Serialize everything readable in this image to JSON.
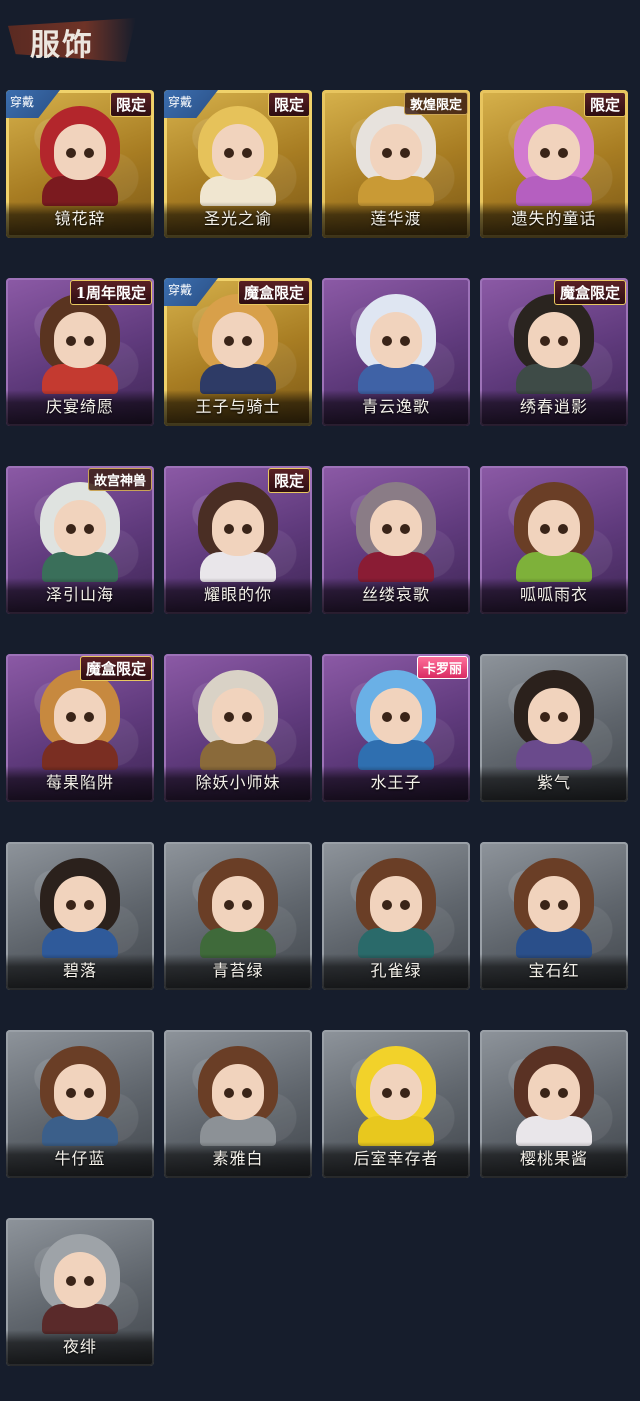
{
  "header": {
    "title": "服饰"
  },
  "costumes": [
    {
      "name": "镜花辞",
      "badge": "限定",
      "badge_style": "",
      "worn": true,
      "frame": "gold",
      "hair": "#b3262c",
      "outfit": "#7b1a1f"
    },
    {
      "name": "圣光之谕",
      "badge": "限定",
      "badge_style": "",
      "worn": true,
      "frame": "gold",
      "hair": "#e6c25a",
      "outfit": "#f0e6d0"
    },
    {
      "name": "莲华渡",
      "badge": "敦煌限定",
      "badge_style": "calli",
      "worn": false,
      "frame": "gold",
      "hair": "#e7e2dd",
      "outfit": "#c99a35"
    },
    {
      "name": "遗失的童话",
      "badge": "限定",
      "badge_style": "",
      "worn": false,
      "frame": "gold",
      "hair": "#d27bcf",
      "outfit": "#b55fc0"
    },
    {
      "name": "庆宴绮愿",
      "badge": "1周年限定",
      "badge_style": "",
      "worn": false,
      "frame": "purple",
      "hair": "#5a3420",
      "outfit": "#c43a30"
    },
    {
      "name": "王子与骑士",
      "badge": "魔盒限定",
      "badge_style": "",
      "worn": true,
      "frame": "gold",
      "hair": "#d8a04a",
      "outfit": "#2e3b66"
    },
    {
      "name": "青云逸歌",
      "badge": "",
      "badge_style": "",
      "worn": false,
      "frame": "purple",
      "hair": "#dfe6f2",
      "outfit": "#3f62a6"
    },
    {
      "name": "绣春逍影",
      "badge": "魔盒限定",
      "badge_style": "",
      "worn": false,
      "frame": "purple",
      "hair": "#2a241f",
      "outfit": "#3e4b47"
    },
    {
      "name": "泽引山海",
      "badge": "故宫神兽",
      "badge_style": "calli",
      "worn": false,
      "frame": "purple",
      "hair": "#dfe3e0",
      "outfit": "#3a6f5a"
    },
    {
      "name": "耀眼的你",
      "badge": "限定",
      "badge_style": "",
      "worn": false,
      "frame": "purple",
      "hair": "#4a2e24",
      "outfit": "#e9e6ea"
    },
    {
      "name": "丝缕哀歌",
      "badge": "",
      "badge_style": "",
      "worn": false,
      "frame": "purple",
      "hair": "#8a7c86",
      "outfit": "#8a1c34"
    },
    {
      "name": "呱呱雨衣",
      "badge": "",
      "badge_style": "",
      "worn": false,
      "frame": "purple",
      "hair": "#6a3e26",
      "outfit": "#7eb13a"
    },
    {
      "name": "莓果陷阱",
      "badge": "魔盒限定",
      "badge_style": "",
      "worn": false,
      "frame": "purple",
      "hair": "#c7893f",
      "outfit": "#7a2e22"
    },
    {
      "name": "除妖小师妹",
      "badge": "",
      "badge_style": "",
      "worn": false,
      "frame": "purple",
      "hair": "#d9d2c6",
      "outfit": "#8a6a3a"
    },
    {
      "name": "水王子",
      "badge": "卡罗丽",
      "badge_style": "pink",
      "worn": false,
      "frame": "purple",
      "hair": "#6ab0e6",
      "outfit": "#2f6fb0"
    },
    {
      "name": "紫气",
      "badge": "",
      "badge_style": "",
      "worn": false,
      "frame": "gray",
      "hair": "#2b211c",
      "outfit": "#6a4a8c"
    },
    {
      "name": "碧落",
      "badge": "",
      "badge_style": "",
      "worn": false,
      "frame": "gray",
      "hair": "#2b211c",
      "outfit": "#2f5a9a"
    },
    {
      "name": "青苔绿",
      "badge": "",
      "badge_style": "",
      "worn": false,
      "frame": "gray",
      "hair": "#6a3e26",
      "outfit": "#3f6a3a"
    },
    {
      "name": "孔雀绿",
      "badge": "",
      "badge_style": "",
      "worn": false,
      "frame": "gray",
      "hair": "#6a3e26",
      "outfit": "#2a6a6a"
    },
    {
      "name": "宝石红",
      "badge": "",
      "badge_style": "",
      "worn": false,
      "frame": "gray",
      "hair": "#6a3e26",
      "outfit": "#2a4f8a"
    },
    {
      "name": "牛仔蓝",
      "badge": "",
      "badge_style": "",
      "worn": false,
      "frame": "gray",
      "hair": "#6a3e26",
      "outfit": "#3b5f8a"
    },
    {
      "name": "素雅白",
      "badge": "",
      "badge_style": "",
      "worn": false,
      "frame": "gray",
      "hair": "#6a3e26",
      "outfit": "#8c9196"
    },
    {
      "name": "后室幸存者",
      "badge": "",
      "badge_style": "",
      "worn": false,
      "frame": "gray",
      "hair": "#f2d22a",
      "outfit": "#e8c81e"
    },
    {
      "name": "樱桃果酱",
      "badge": "",
      "badge_style": "",
      "worn": false,
      "frame": "gray",
      "hair": "#5a3224",
      "outfit": "#e9e6ea"
    },
    {
      "name": "夜绯",
      "badge": "",
      "badge_style": "",
      "worn": false,
      "frame": "gray",
      "hair": "#9ea3a8",
      "outfit": "#5a2a2a"
    }
  ],
  "worn_label": "穿戴"
}
